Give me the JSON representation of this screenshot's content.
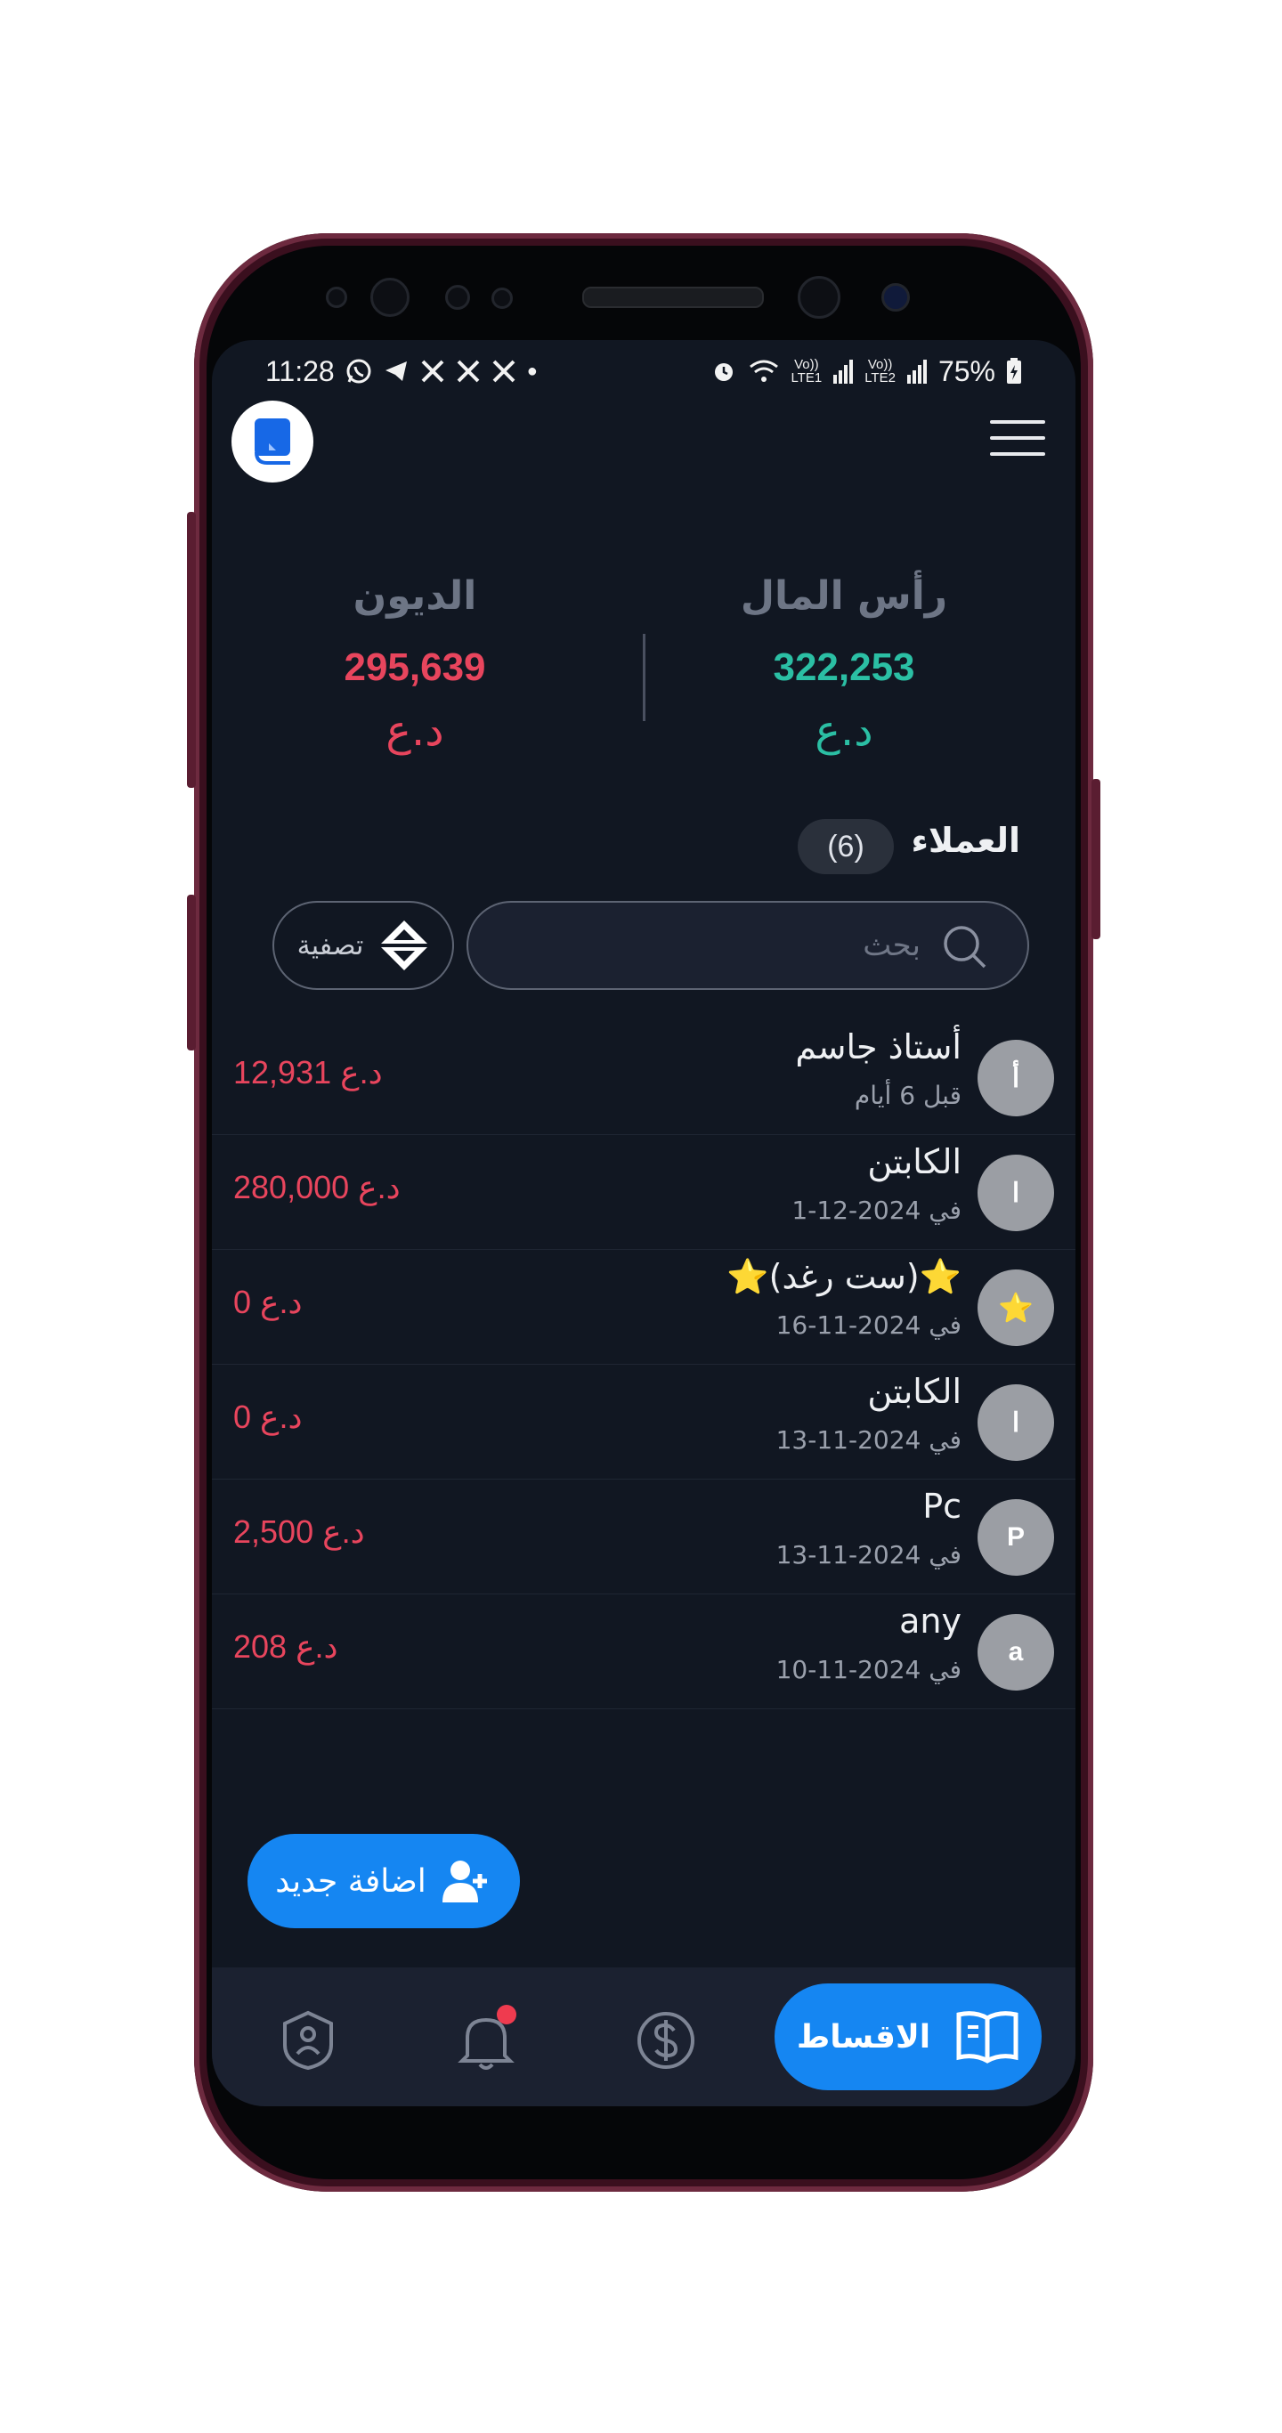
{
  "status_bar": {
    "time": "11:28",
    "sim1": "Vo))\nLTE1",
    "sim2": "Vo))\nLTE2",
    "battery": "75%"
  },
  "summary": {
    "capital": {
      "title": "رأس المال",
      "value": "322,253",
      "currency": "د.ع",
      "color": "#2bbfa4"
    },
    "debts": {
      "title": "الديون",
      "value": "295,639",
      "currency": "د.ع",
      "color": "#e8455d"
    }
  },
  "clients": {
    "title": "العملاء",
    "count": "(6)",
    "filter_label": "تصفية",
    "search_placeholder": "بحث",
    "items": [
      {
        "initial": "أ",
        "name": "أستاذ جاسم",
        "date": "قبل 6 أيام",
        "amount": "12,931 د.ع"
      },
      {
        "initial": "ا",
        "name": "الكابتن",
        "date": "في 2024-12-1",
        "amount": "280,000 د.ع"
      },
      {
        "initial": "⭐",
        "name": "⭐(ست رغد)⭐",
        "date": "في 2024-11-16",
        "amount": "0 د.ع"
      },
      {
        "initial": "ا",
        "name": "الكابتن",
        "date": "في 2024-11-13",
        "amount": "0 د.ع"
      },
      {
        "initial": "P",
        "name": "Pc",
        "date": "في 2024-11-13",
        "amount": "2,500 د.ع"
      },
      {
        "initial": "a",
        "name": "any",
        "date": "في 2024-11-10",
        "amount": "208 د.ع"
      }
    ]
  },
  "add_button_label": "اضافة جديد",
  "bottom_nav": {
    "active_label": "الاقساط",
    "items": [
      "account-icon",
      "bell-icon",
      "dollar-icon",
      "book-icon"
    ]
  },
  "colors": {
    "accent": "#1586f2",
    "background": "#111722",
    "positive": "#2bbfa4",
    "negative": "#e8455d"
  }
}
